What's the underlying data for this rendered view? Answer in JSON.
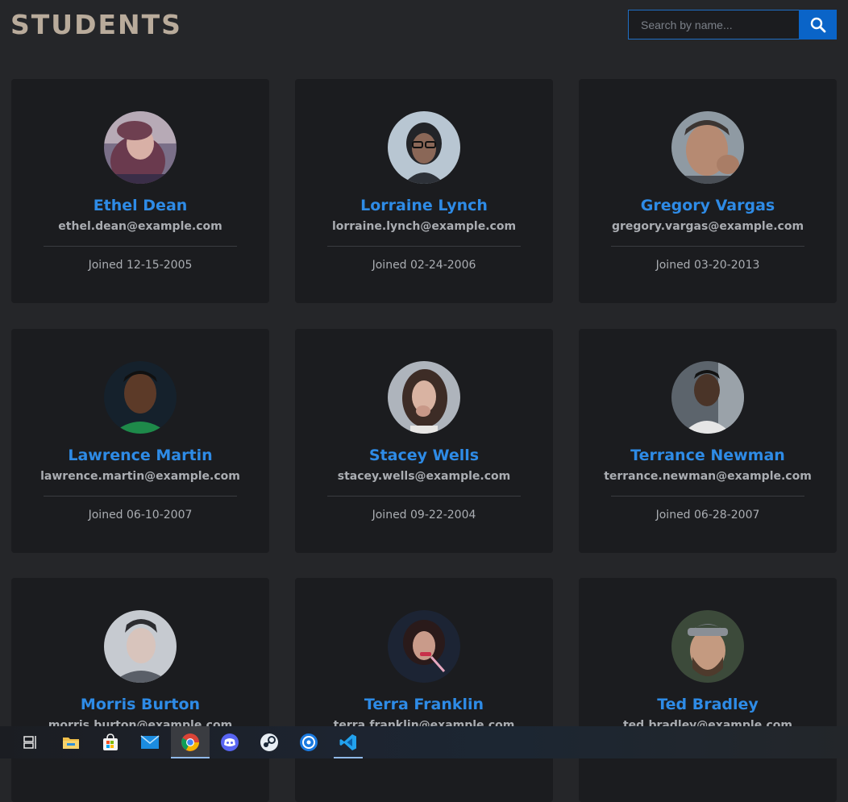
{
  "header": {
    "title": "STUDENTS",
    "search": {
      "placeholder": "Search by name...",
      "value": ""
    }
  },
  "students": [
    {
      "name": "Ethel Dean",
      "email": "ethel.dean@example.com",
      "joined": "Joined 12-15-2005"
    },
    {
      "name": "Lorraine Lynch",
      "email": "lorraine.lynch@example.com",
      "joined": "Joined 02-24-2006"
    },
    {
      "name": "Gregory Vargas",
      "email": "gregory.vargas@example.com",
      "joined": "Joined 03-20-2013"
    },
    {
      "name": "Lawrence Martin",
      "email": "lawrence.martin@example.com",
      "joined": "Joined 06-10-2007"
    },
    {
      "name": "Stacey Wells",
      "email": "stacey.wells@example.com",
      "joined": "Joined 09-22-2004"
    },
    {
      "name": "Terrance Newman",
      "email": "terrance.newman@example.com",
      "joined": "Joined 06-28-2007"
    },
    {
      "name": "Morris Burton",
      "email": "morris.burton@example.com",
      "joined": ""
    },
    {
      "name": "Terra Franklin",
      "email": "terra.franklin@example.com",
      "joined": ""
    },
    {
      "name": "Ted Bradley",
      "email": "ted.bradley@example.com",
      "joined": ""
    }
  ],
  "taskbar": {
    "apps": [
      {
        "icon": "task-view-icon"
      },
      {
        "icon": "file-explorer-icon"
      },
      {
        "icon": "microsoft-store-icon"
      },
      {
        "icon": "mail-icon"
      },
      {
        "icon": "chrome-icon",
        "state": "active"
      },
      {
        "icon": "discord-icon"
      },
      {
        "icon": "steam-icon"
      },
      {
        "icon": "app-icon"
      },
      {
        "icon": "vscode-icon",
        "state": "running"
      }
    ]
  },
  "colors": {
    "background": "#252629",
    "card": "#1b1c1f",
    "name": "#2e8be6",
    "title": "#b9ab9b",
    "accent": "#0a64c8"
  }
}
